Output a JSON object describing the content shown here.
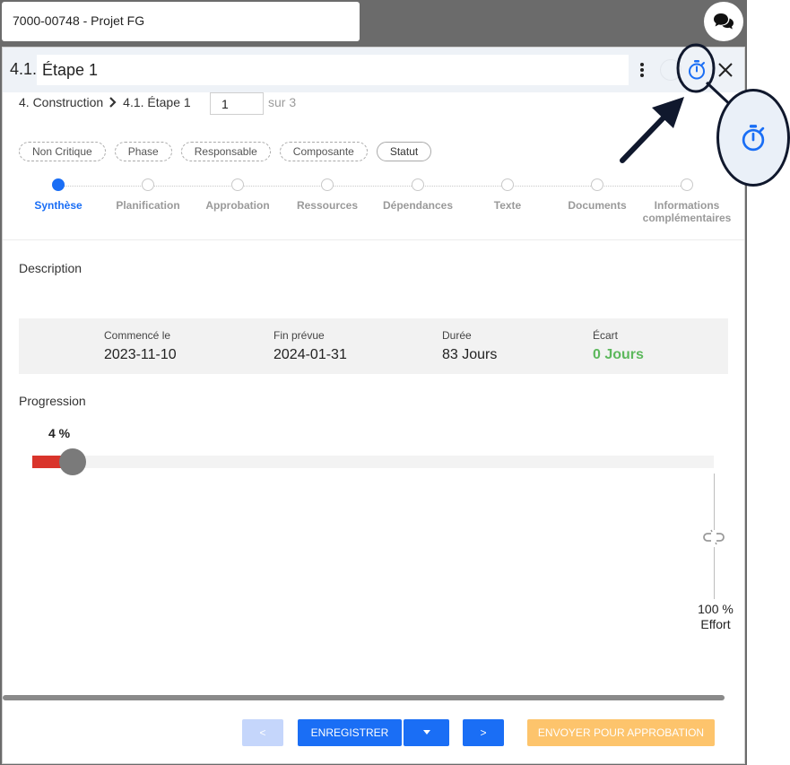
{
  "project_tab": {
    "label": "7000-00748 - Projet FG"
  },
  "modal": {
    "step_prefix": "4.1.",
    "title_value": "Étape 1",
    "breadcrumb": {
      "parent": "4. Construction",
      "current": "4.1. Étape 1"
    },
    "pager": {
      "value": "1",
      "total": "sur 3"
    },
    "chips": [
      "Non Critique",
      "Phase",
      "Responsable",
      "Composante",
      "Statut"
    ],
    "steps": [
      {
        "label": "Synthèse",
        "active": true
      },
      {
        "label": "Planification"
      },
      {
        "label": "Approbation"
      },
      {
        "label": "Ressources"
      },
      {
        "label": "Dépendances"
      },
      {
        "label": "Texte"
      },
      {
        "label": "Documents"
      },
      {
        "label": "Informations complémentaires"
      }
    ],
    "description_label": "Description",
    "summary": {
      "start_label": "Commencé le",
      "start_value": "2023-11-10",
      "end_label": "Fin prévue",
      "end_value": "2024-01-31",
      "duration_label": "Durée",
      "duration_value": "83 Jours",
      "gap_label": "Écart",
      "gap_value": "0 Jours"
    },
    "progress": {
      "label": "Progression",
      "value_text": "4 %",
      "value": 4
    },
    "effort": {
      "value_text": "100 %",
      "label": "Effort",
      "value": 100
    },
    "buttons": {
      "prev": "<",
      "save": "ENREGISTRER",
      "next": ">",
      "send_approval": "ENVOYER POUR APPROBATION"
    }
  },
  "colors": {
    "accent": "#1a6ef5",
    "progress_fill": "#d9342b",
    "positive": "#5cb85c",
    "approval": "#fdc46c",
    "annotation": "#10182d"
  },
  "icons": [
    "chat-bubbles-icon",
    "kebab-menu-icon",
    "stopwatch-icon",
    "close-icon",
    "chevron-right-icon",
    "caret-down-icon",
    "broken-link-icon",
    "arrow-annotation"
  ]
}
